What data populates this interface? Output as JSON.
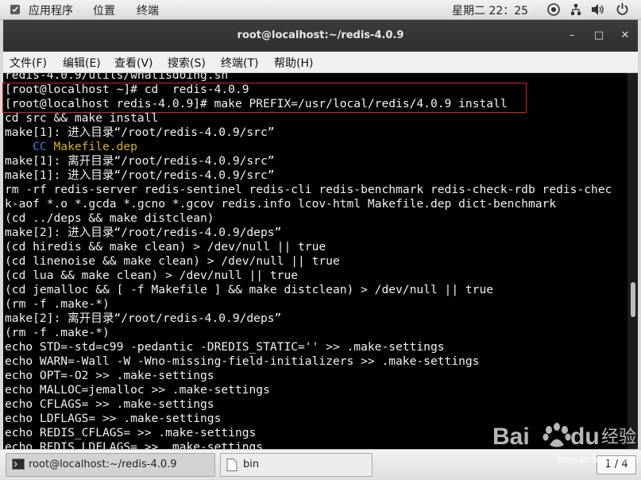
{
  "top_bar": {
    "applications": "应用程序",
    "places": "位置",
    "terminal": "终端",
    "clock": "星期二 22：25",
    "icons": [
      "accessibility-icon",
      "network-icon",
      "volume-icon",
      "power-icon"
    ]
  },
  "window": {
    "title": "root@localhost:~/redis-4.0.9",
    "controls": {
      "minimize": "–",
      "maximize": "□",
      "close": "✕"
    }
  },
  "menu": [
    "文件(F)",
    "编辑(E)",
    "查看(V)",
    "搜索(S)",
    "终端(T)",
    "帮助(H)"
  ],
  "terminal_lines": [
    "redis-4.0.9/utils/whatisdoing.sh",
    "[root@localhost ~]# cd  redis-4.0.9",
    "[root@localhost redis-4.0.9]# make PREFIX=/usr/local/redis/4.0.9 install",
    "cd src && make install",
    "make[1]: 进入目录“/root/redis-4.0.9/src”",
    "    CC Makefile.dep",
    "make[1]: 离开目录“/root/redis-4.0.9/src”",
    "make[1]: 进入目录“/root/redis-4.0.9/src”",
    "rm -rf redis-server redis-sentinel redis-cli redis-benchmark redis-check-rdb redis-chec",
    "k-aof *.o *.gcda *.gcno *.gcov redis.info lcov-html Makefile.dep dict-benchmark",
    "(cd ../deps && make distclean)",
    "make[2]: 进入目录“/root/redis-4.0.9/deps”",
    "(cd hiredis && make clean) > /dev/null || true",
    "(cd linenoise && make clean) > /dev/null || true",
    "(cd lua && make clean) > /dev/null || true",
    "(cd jemalloc && [ -f Makefile ] && make distclean) > /dev/null || true",
    "(rm -f .make-*)",
    "make[2]: 离开目录“/root/redis-4.0.9/deps”",
    "(rm -f .make-*)",
    "echo STD=-std=c99 -pedantic -DREDIS_STATIC='' >> .make-settings",
    "echo WARN=-Wall -W -Wno-missing-field-initializers >> .make-settings",
    "echo OPT=-O2 >> .make-settings",
    "echo MALLOC=jemalloc >> .make-settings",
    "echo CFLAGS= >> .make-settings",
    "echo LDFLAGS= >> .make-settings",
    "echo REDIS_CFLAGS= >> .make-settings",
    "echo REDIS_LDFLAGS= >> .make-settings"
  ],
  "cc_line": {
    "prefix": "    CC ",
    "file": "Makefile.dep"
  },
  "taskbar": {
    "items": [
      "root@localhost:~/redis-4.0.9",
      "bin"
    ],
    "pager": "1 / 4"
  },
  "watermark": {
    "logo": "Baidu经验",
    "url": "jingyan.baidu.com"
  },
  "colors": {
    "highlight_box": "#e0202a",
    "cc_keyword": "#3d7fd6",
    "makefile_name": "#d9b20a"
  }
}
